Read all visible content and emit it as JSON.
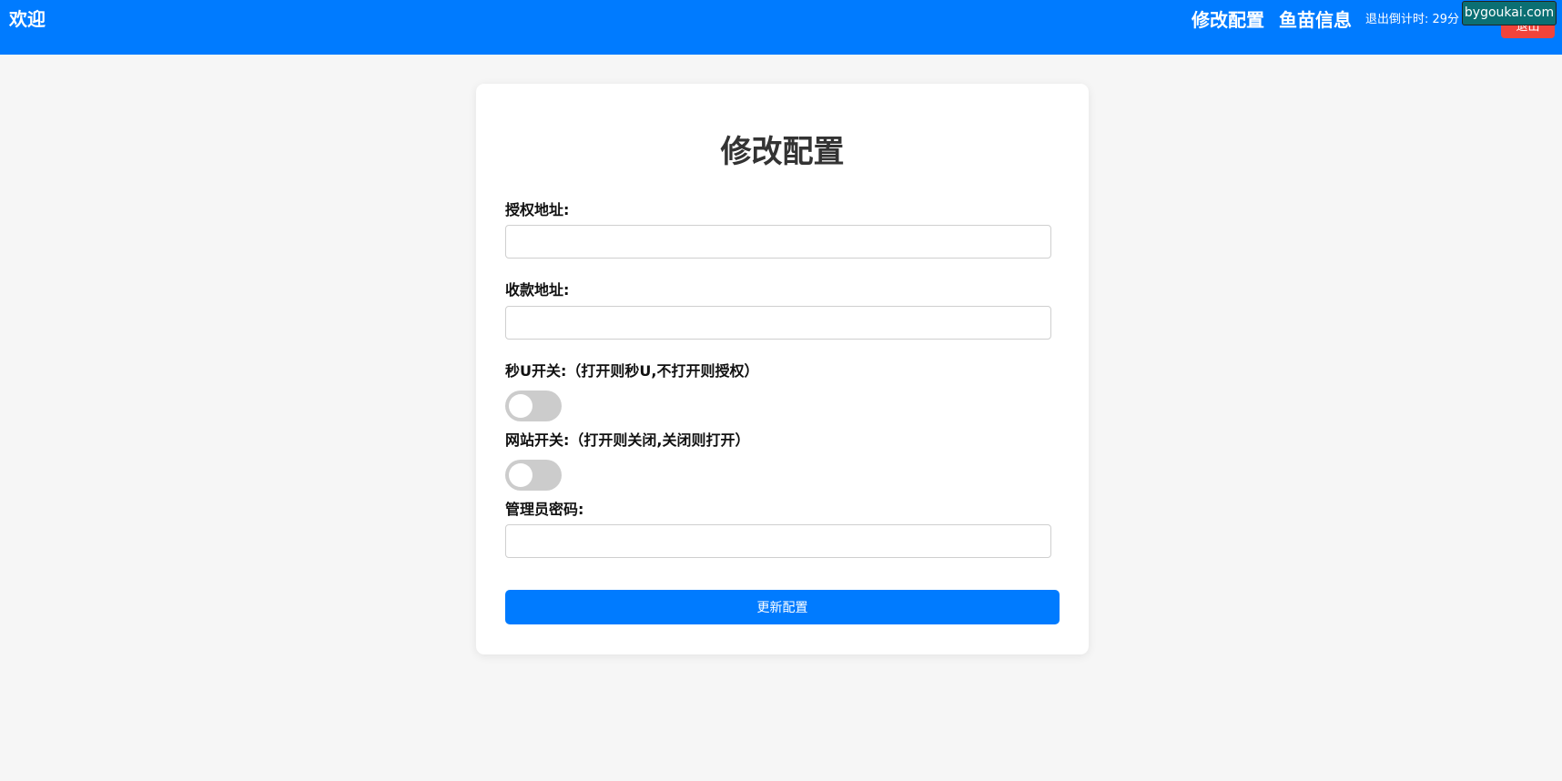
{
  "header": {
    "brand": "欢迎",
    "nav": [
      "修改配置",
      "鱼苗信息"
    ],
    "countdown": "退出倒计时:  29分",
    "logout_label": "退出",
    "watermark": "bygoukai.com"
  },
  "form": {
    "title": "修改配置",
    "auth_address_label": "授权地址:",
    "auth_address_value": "",
    "payment_address_label": "收款地址:",
    "payment_address_value": "",
    "instant_u_switch_label": "秒U开关:（打开则秒U,不打开则授权）",
    "instant_u_switch_on": false,
    "site_switch_label": "网站开关:（打开则关闭,关闭则打开）",
    "site_switch_on": false,
    "admin_password_label": "管理员密码:",
    "admin_password_value": "",
    "submit_label": "更新配置"
  },
  "colors": {
    "header_bg": "#007bff",
    "logout_bg": "#f1443b",
    "submit_bg": "#007bff",
    "switch_off": "#cccccc"
  }
}
